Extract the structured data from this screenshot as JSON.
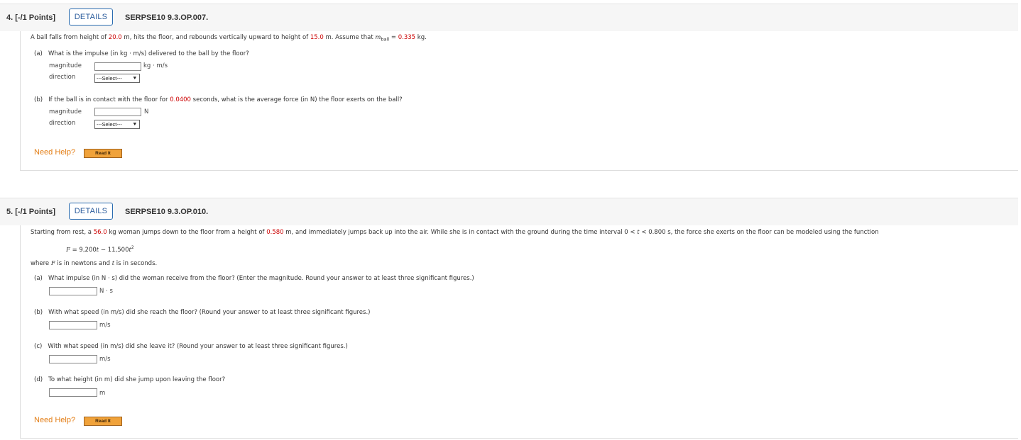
{
  "q4": {
    "number": "4.",
    "points": "[-/1 Points]",
    "details_label": "DETAILS",
    "id": "SERPSE10 9.3.OP.007.",
    "stem": {
      "pre": "A ball falls from height of ",
      "h1": "20.0",
      "mid1": " m, hits the floor, and rebounds vertically upward to height of ",
      "h2": "15.0",
      "mid2": " m. Assume that ",
      "m_sym": "m",
      "m_sub": "ball",
      "eq": " = ",
      "mass": "0.335",
      "unit": " kg."
    },
    "part_a": {
      "letter": "(a)",
      "text": "What is the impulse (in kg · m/s) delivered to the ball by the floor?",
      "magnitude_label": "magnitude",
      "magnitude_value": "",
      "unit": "kg · m/s",
      "direction_label": "direction",
      "direction_value": "---Select---"
    },
    "part_b": {
      "letter": "(b)",
      "pre": "If the ball is in contact with the floor for ",
      "time": "0.0400",
      "post": " seconds, what is the average force (in N) the floor exerts on the ball?",
      "magnitude_label": "magnitude",
      "magnitude_value": "",
      "unit": "N",
      "direction_label": "direction",
      "direction_value": "---Select---"
    },
    "help": "Need Help?",
    "read_it": "Read It"
  },
  "q5": {
    "number": "5.",
    "points": "[-/1 Points]",
    "details_label": "DETAILS",
    "id": "SERPSE10 9.3.OP.010.",
    "stem": {
      "pre": "Starting from rest, a ",
      "mass": "56.0",
      "mid1": " kg woman jumps down to the floor from a height of ",
      "height": "0.580",
      "mid2": " m, and immediately jumps back up into the air. While she is in contact with the ground during the time interval 0 < ",
      "t_sym": "t",
      "mid3": " < ",
      "tmax": "0.800",
      "post": " s, the force she exerts on the floor can be modeled using the function"
    },
    "equation": {
      "F": "F",
      "eq": " = 9,200",
      "t1": "t",
      "minus": " − 11,500",
      "t2": "t",
      "sup": "2"
    },
    "where": {
      "F": "F",
      "mid": " is in newtons and ",
      "t": "t",
      "post": " is in seconds."
    },
    "part_a": {
      "letter": "(a)",
      "text": "What impulse (in N · s) did the woman receive from the floor? (Enter the magnitude. Round your answer to at least three significant figures.)",
      "value": "",
      "unit": "N · s"
    },
    "part_b": {
      "letter": "(b)",
      "text": "With what speed (in m/s) did she reach the floor? (Round your answer to at least three significant figures.)",
      "value": "",
      "unit": "m/s"
    },
    "part_c": {
      "letter": "(c)",
      "text": "With what speed (in m/s) did she leave it? (Round your answer to at least three significant figures.)",
      "value": "",
      "unit": "m/s"
    },
    "part_d": {
      "letter": "(d)",
      "text": "To what height (in m) did she jump upon leaving the floor?",
      "value": "",
      "unit": "m"
    },
    "help": "Need Help?",
    "read_it": "Read It"
  }
}
